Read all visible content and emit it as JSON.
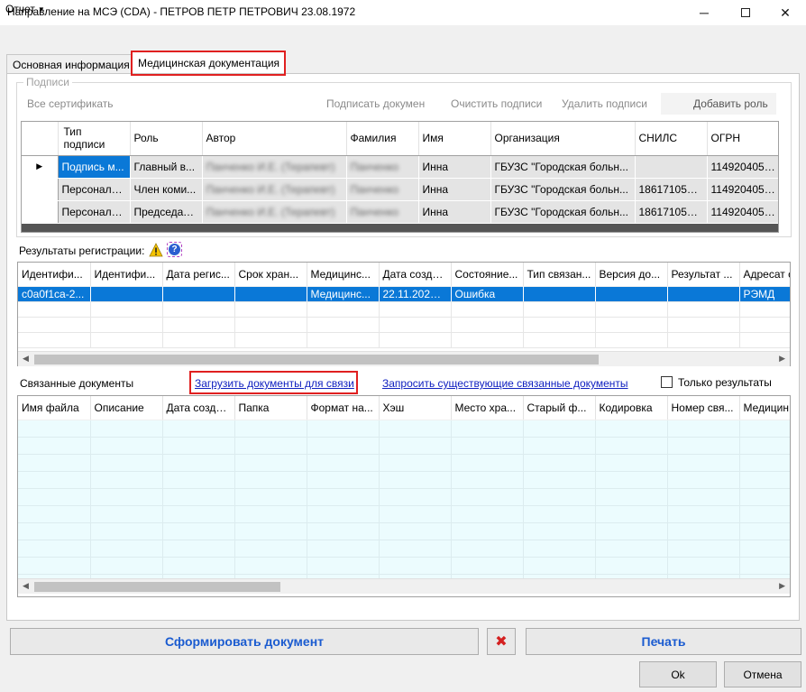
{
  "window": {
    "title": "Направление на МСЭ (CDA) - ПЕТРОВ ПЕТР ПЕТРОВИЧ 23.08.1972",
    "minimize": "─",
    "close": "✕"
  },
  "menu": {
    "report": "Отчет"
  },
  "tabs": [
    {
      "label": "Основная информация"
    },
    {
      "label": "Медицинская документация"
    }
  ],
  "signatures": {
    "group_label": "Подписи",
    "toolbar": {
      "all_certs": "Все сертификать",
      "sign_doc": "Подписать докумен",
      "clear_sigs": "Очистить подписи",
      "delete_sig": "Удалить подписи",
      "add_role": "Добавить роль"
    },
    "columns": [
      "Тип подписи",
      "Роль",
      "Автор",
      "Фамилия",
      "Имя",
      "Организация",
      "СНИЛС",
      "ОГРН"
    ],
    "rows": [
      [
        "Подпись м...",
        "Главный в...",
        "Панченко И.Е. (Терапевт)",
        "Панченко",
        "Инна",
        "ГБУЗС \"Городская больн...",
        "",
        "1149204050..."
      ],
      [
        "Персональ...",
        "Член коми...",
        "Панченко И.Е. (Терапевт)",
        "Панченко",
        "Инна",
        "ГБУЗС \"Городская больн...",
        "18617105978",
        "1149204050..."
      ],
      [
        "Персональ...",
        "Председате...",
        "Панченко И.Е. (Терапевт)",
        "Панченко",
        "Инна",
        "ГБУЗС \"Городская больн...",
        "18617105978",
        "1149204050..."
      ]
    ],
    "current_row_marker": "▶"
  },
  "registration": {
    "label": "Результаты регистрации:",
    "help_glyph": "?",
    "columns": [
      "Идентифи...",
      "Идентифи...",
      "Дата регис...",
      "Срок хран...",
      "Медицинс...",
      "Дата созда...",
      "Состояние...",
      "Тип связан...",
      "Версия до...",
      "Результат ...",
      "Адресат с"
    ],
    "rows": [
      [
        "c0a0f1ca-2...",
        "",
        "",
        "",
        "Медицинс...",
        "22.11.2022 ...",
        "Ошибка",
        "",
        "",
        "",
        "РЭМД"
      ]
    ]
  },
  "related": {
    "label": "Связанные документы",
    "load_link": "Загрузить документы для связи",
    "request_link": "Запросить существующие связанные документы",
    "only_results": "Только результаты",
    "columns": [
      "Имя файла",
      "Описание",
      "Дата созда...",
      "Папка",
      "Формат на...",
      "Хэш",
      "Место хра...",
      "Старый ф...",
      "Кодировка",
      "Номер свя...",
      "Медицин"
    ]
  },
  "scroll": {
    "left": "◀",
    "right": "▶"
  },
  "buttons": {
    "form_document": "Сформировать документ",
    "delete_glyph": "✖",
    "print": "Печать",
    "ok": "Ok",
    "cancel": "Отмена"
  },
  "colors": {
    "selection": "#0a78d7",
    "highlight_border": "#e02020",
    "link": "#1020c0",
    "action_text": "#1a5bd0",
    "related_rows_bg": "#ecfcfe"
  }
}
